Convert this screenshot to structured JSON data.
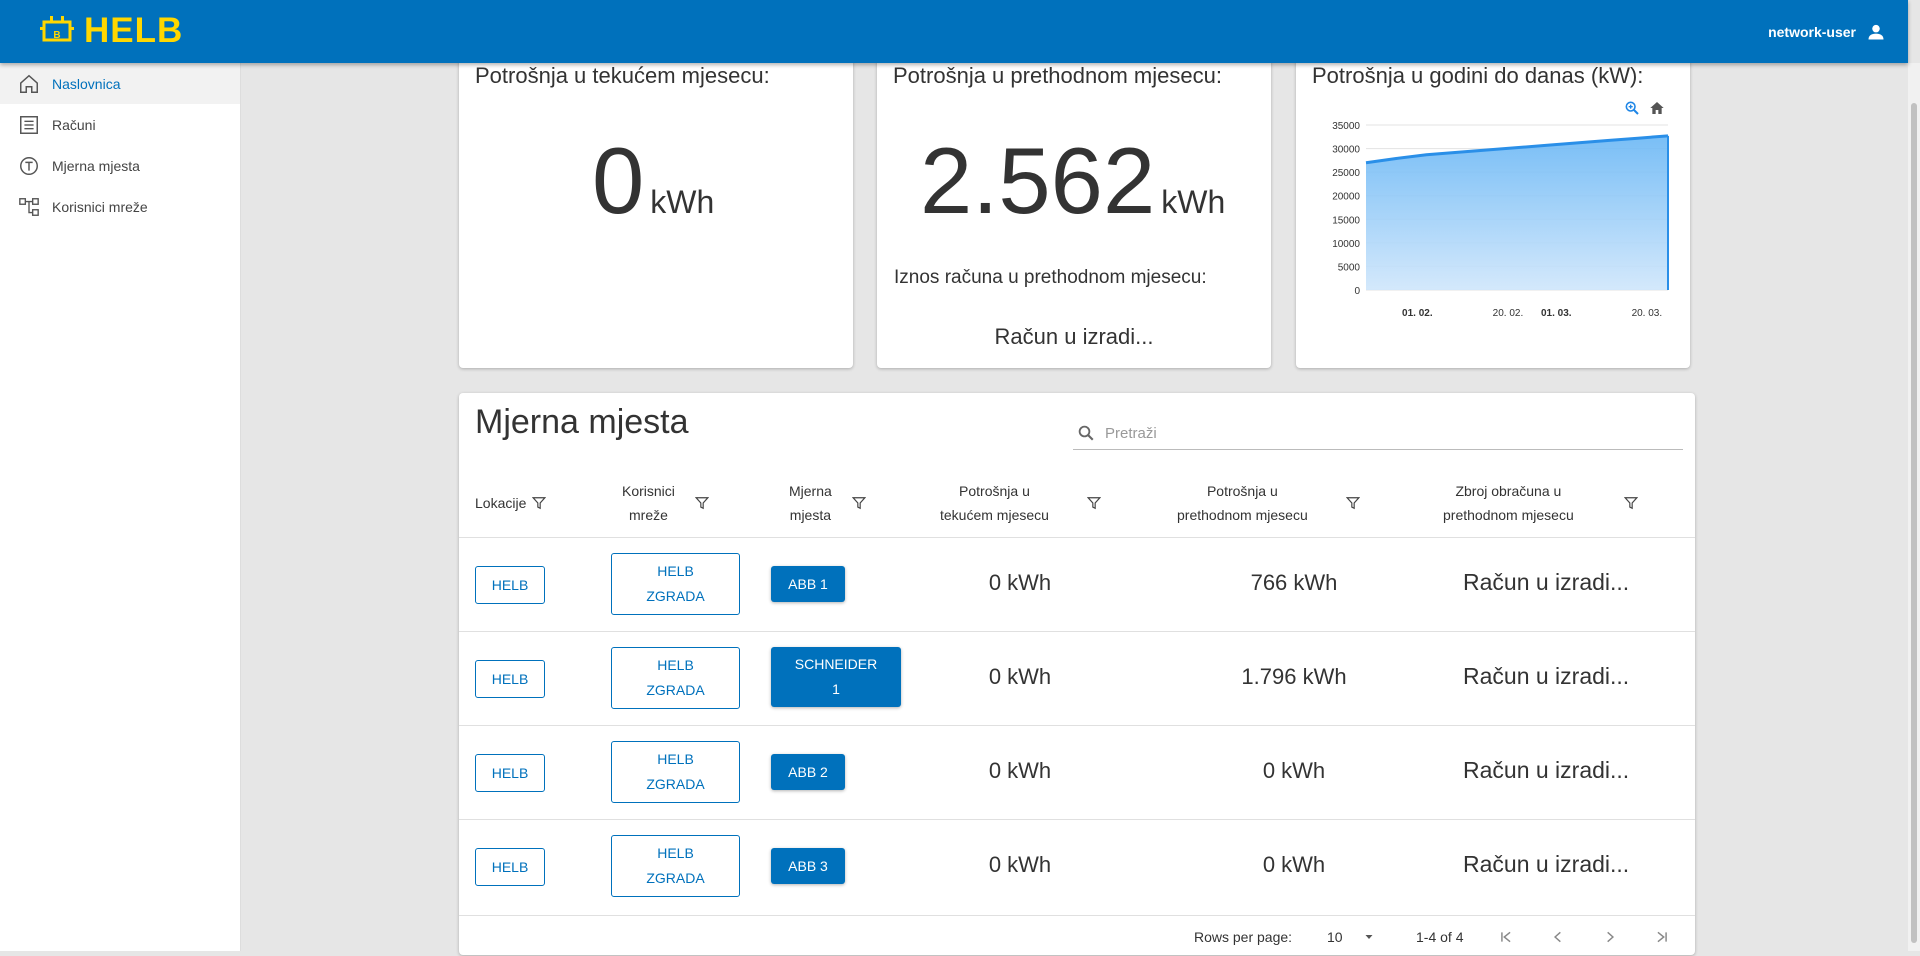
{
  "app": {
    "logo_text": "HELB",
    "user_name": "network-user"
  },
  "sidebar": {
    "items": [
      {
        "label": "Naslovnica",
        "icon": "home-icon",
        "active": true
      },
      {
        "label": "Računi",
        "icon": "list-icon",
        "active": false
      },
      {
        "label": "Mjerna mjesta",
        "icon": "meter-icon",
        "active": false
      },
      {
        "label": "Korisnici mreže",
        "icon": "network-icon",
        "active": false
      }
    ]
  },
  "cards": {
    "current": {
      "title": "Potrošnja u tekućem mjesecu:",
      "value": "0",
      "unit": "kWh"
    },
    "previous": {
      "title": "Potrošnja u prethodnom mjesecu:",
      "value": "2.562",
      "unit": "kWh",
      "bill_label": "Iznos računa u prethodnom mjesecu:",
      "bill_value": "Račun u izradi..."
    },
    "yearly": {
      "title": "Potrošnja u godini do danas (kW):"
    }
  },
  "chart_data": {
    "type": "area",
    "title": "Potrošnja u godini do danas (kW):",
    "ylim": [
      0,
      35000
    ],
    "yticks": [
      "35000",
      "30000",
      "25000",
      "20000",
      "15000",
      "10000",
      "5000",
      "0"
    ],
    "xticks": [
      {
        "label": "01. 02.",
        "pos": 0.17,
        "bold": true
      },
      {
        "label": "20. 02.",
        "pos": 0.47,
        "bold": false
      },
      {
        "label": "01. 03.",
        "pos": 0.63,
        "bold": true
      },
      {
        "label": "20. 03.",
        "pos": 0.93,
        "bold": false
      }
    ],
    "x": [
      0,
      0.1,
      0.2,
      0.3,
      0.4,
      0.5,
      0.6,
      0.7,
      0.8,
      0.9,
      1.0
    ],
    "values": [
      27000,
      27900,
      28700,
      29200,
      29700,
      30200,
      30700,
      31200,
      31700,
      32200,
      32700
    ],
    "color": "#2a8fe8",
    "grid": true
  },
  "table": {
    "title": "Mjerna mjesta",
    "search_placeholder": "Pretraži",
    "headers": [
      {
        "line1": "Lokacije",
        "line2": ""
      },
      {
        "line1": "Korisnici",
        "line2": "mreže"
      },
      {
        "line1": "Mjerna",
        "line2": "mjesta"
      },
      {
        "line1": "Potrošnja u",
        "line2": "tekućem mjesecu"
      },
      {
        "line1": "Potrošnja u",
        "line2": "prethodnom mjesecu"
      },
      {
        "line1": "Zbroj obračuna u",
        "line2": "prethodnom mjesecu"
      }
    ],
    "rows": [
      {
        "location": "HELB",
        "user_l1": "HELB",
        "user_l2": "ZGRADA",
        "meter_l1": "ABB 1",
        "meter_l2": "",
        "current": "0 kWh",
        "previous": "766 kWh",
        "bill": "Račun u izradi..."
      },
      {
        "location": "HELB",
        "user_l1": "HELB",
        "user_l2": "ZGRADA",
        "meter_l1": "SCHNEIDER",
        "meter_l2": "1",
        "current": "0 kWh",
        "previous": "1.796 kWh",
        "bill": "Račun u izradi..."
      },
      {
        "location": "HELB",
        "user_l1": "HELB",
        "user_l2": "ZGRADA",
        "meter_l1": "ABB 2",
        "meter_l2": "",
        "current": "0 kWh",
        "previous": "0 kWh",
        "bill": "Račun u izradi..."
      },
      {
        "location": "HELB",
        "user_l1": "HELB",
        "user_l2": "ZGRADA",
        "meter_l1": "ABB 3",
        "meter_l2": "",
        "current": "0 kWh",
        "previous": "0 kWh",
        "bill": "Račun u izradi..."
      }
    ],
    "footer": {
      "rows_per_page_label": "Rows per page:",
      "rows_per_page": "10",
      "range": "1-4 of 4"
    }
  },
  "colors": {
    "primary": "#0071bc",
    "logo_yellow": "#ffd700",
    "background": "#e6e6e6"
  }
}
